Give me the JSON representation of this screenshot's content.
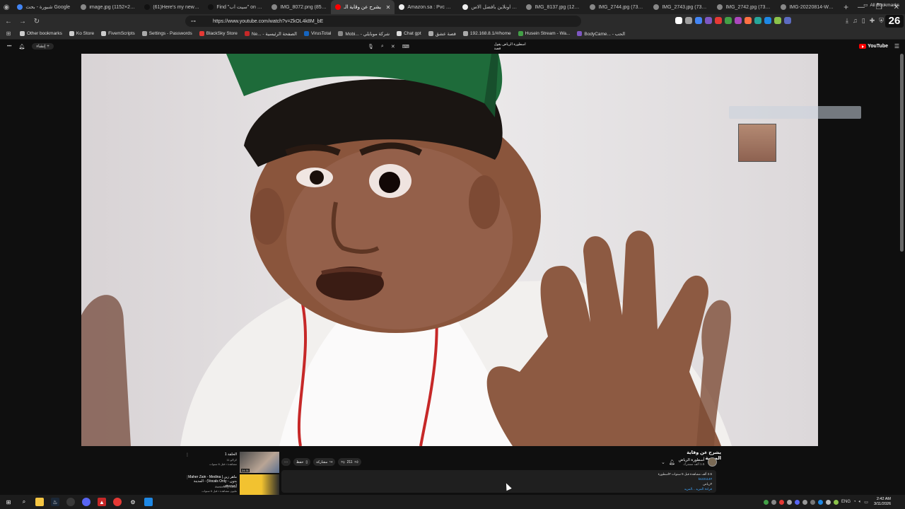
{
  "browser": {
    "tabs": [
      {
        "title": "شبورة - بحث Google",
        "color": "#4285f4"
      },
      {
        "title": "image.jpg (1152×2048)",
        "color": "#888888"
      },
      {
        "title": "(61)Here's my new build",
        "color": "#111111"
      },
      {
        "title": "Find \"سيت اب\" on TikTok",
        "color": "#111111"
      },
      {
        "title": "IMG_8072.png (855×56",
        "color": "#888888"
      },
      {
        "title": "يشرح عن وقاية الـ",
        "color": "#ff0000",
        "active": true
      },
      {
        "title": "Amazon.sa : Pvc wall pa",
        "color": "#eeeeee"
      },
      {
        "title": "اشتري اونلاين بأفضل الاس",
        "color": "#eeeeee"
      },
      {
        "title": "IMG_8137.jpg (1215×21",
        "color": "#888888"
      },
      {
        "title": "IMG_2744.jpg (736×130",
        "color": "#888888"
      },
      {
        "title": "IMG_2743.jpg (736×981)",
        "color": "#888888"
      },
      {
        "title": "IMG_2742.jpg (736×981)",
        "color": "#888888"
      },
      {
        "title": "IMG-20220814-WA073",
        "color": "#888888"
      }
    ],
    "active_tab_close": "✕",
    "new_tab": "+",
    "url": "https://www.youtube.com/watch?v=ZkOL4k8M_bE",
    "profile_badge": "26",
    "bookmarks": [
      {
        "label": "Other bookmarks",
        "color": "#cccccc"
      },
      {
        "label": "Ko Store",
        "color": "#cccccc"
      },
      {
        "label": "FivemScripts",
        "color": "#cccccc"
      },
      {
        "label": "Settings - Passwords",
        "color": "#aaaaaa"
      },
      {
        "label": "BlackSky Store",
        "color": "#e53935"
      },
      {
        "label": "Ne... - الصفحة الرئيسية",
        "color": "#c62828"
      },
      {
        "label": "VirusTotal",
        "color": "#1565c0"
      },
      {
        "label": "Mobi... - شركة موبايلي",
        "color": "#888888"
      },
      {
        "label": "Chat gpt",
        "color": "#dddddd"
      },
      {
        "label": "قصة عشق",
        "color": "#aaaaaa"
      },
      {
        "label": "192.168.8.1/#/home",
        "color": "#aaaaaa"
      },
      {
        "label": "Husein Stream - Wa...",
        "color": "#43a047"
      },
      {
        "label": "BodyCame... - الحب",
        "color": "#7e57c2"
      }
    ],
    "all_bookmarks": "All Bookmarks"
  },
  "youtube": {
    "create_label": "إنشاء",
    "search_query": "اسطورة الرياض يقول قصة",
    "logo_text": "YouTube",
    "video": {
      "title": "يشرح عن وقاية الصحية",
      "channel": "أسطورة الرياض",
      "subscribers": "1.5 ألف مشترك",
      "like_count": "211",
      "share_label": "مشاركة",
      "save_label": "حفظ",
      "desc_line1": "2.6 ألف مشاهدة  قبل 5 سنوات  #اسطورة",
      "desc_tag": "#ks22114",
      "desc_line3": "#رياض",
      "desc_more": "قراءة المزيد ...المزيد"
    },
    "recommended": [
      {
        "title": "الحلقة 1",
        "meta1": "كراكو 11",
        "meta2": "مشاهدة • قبل 6 سنوات",
        "duration": "24:31"
      },
      {
        "title": "Maher Zain - Medina | ماهر زين - المدينة (Vocals Only - بدون موسيقى)",
        "meta1": "Awakening Music",
        "meta2": "مليون مشاهدة • قبل 6 سنوات",
        "duration": ""
      }
    ]
  },
  "taskbar": {
    "language": "ENG",
    "time": "2:42 AM",
    "date": "3/11/2026"
  }
}
